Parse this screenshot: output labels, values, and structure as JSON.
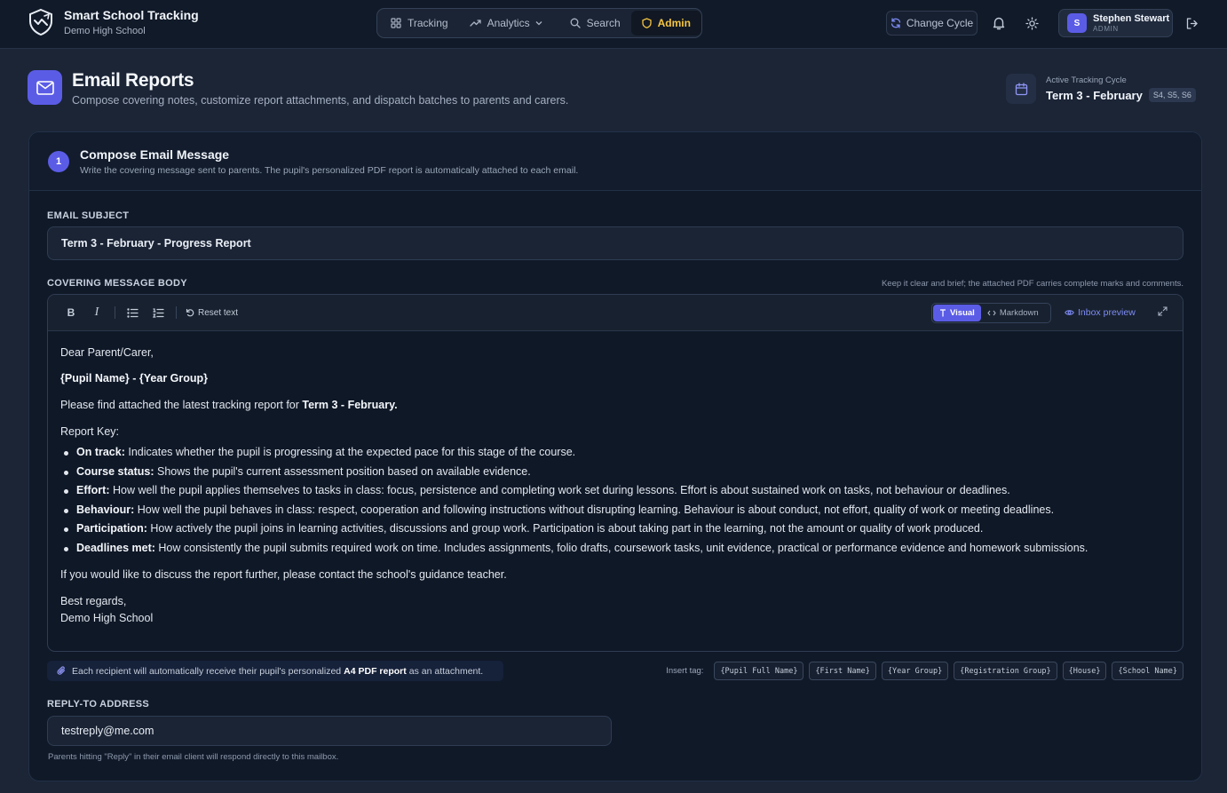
{
  "app": {
    "title": "Smart School Tracking",
    "school": "Demo High School"
  },
  "nav": {
    "items": [
      {
        "label": "Tracking",
        "icon": "grid-icon"
      },
      {
        "label": "Analytics",
        "icon": "trend-icon"
      },
      {
        "label": "Search",
        "icon": "search-icon"
      },
      {
        "label": "Admin",
        "icon": "shield-icon",
        "active": true
      }
    ]
  },
  "header_actions": {
    "change_cycle": "Change Cycle"
  },
  "user": {
    "initial": "S",
    "name": "Stephen Stewart",
    "role": "ADMIN"
  },
  "page": {
    "title": "Email Reports",
    "subtitle": "Compose covering notes, customize report attachments, and dispatch batches to parents and carers."
  },
  "cycle": {
    "label": "Active Tracking Cycle",
    "value": "Term 3 - February",
    "groups": "S4, S5, S6"
  },
  "compose": {
    "step": "1",
    "title": "Compose Email Message",
    "description": "Write the covering message sent to parents. The pupil's personalized PDF report is automatically attached to each email."
  },
  "subject": {
    "label": "EMAIL SUBJECT",
    "value": "Term 3 - February - Progress Report"
  },
  "body": {
    "label": "COVERING MESSAGE BODY",
    "hint": "Keep it clear and brief; the attached PDF carries complete marks and comments."
  },
  "toolbar": {
    "bold": "B",
    "italic": "I",
    "reset": "Reset text",
    "visual": "Visual",
    "markdown": "Markdown",
    "preview": "Inbox preview"
  },
  "message": {
    "greeting": "Dear Parent/Carer,",
    "pupil_line": "{Pupil Name} - {Year Group}",
    "intro_prefix": "Please find attached the latest tracking report for ",
    "intro_term": "Term 3 - February.",
    "key_heading": "Report Key:",
    "key_items": [
      {
        "term": "On track:",
        "text": " Indicates whether the pupil is progressing at the expected pace for this stage of the course."
      },
      {
        "term": "Course status:",
        "text": " Shows the pupil's current assessment position based on available evidence."
      },
      {
        "term": "Effort:",
        "text": " How well the pupil applies themselves to tasks in class: focus, persistence and completing work set during lessons. Effort is about sustained work on tasks, not behaviour or deadlines."
      },
      {
        "term": "Behaviour:",
        "text": " How well the pupil behaves in class: respect, cooperation and following instructions without disrupting learning. Behaviour is about conduct, not effort, quality of work or meeting deadlines."
      },
      {
        "term": "Participation:",
        "text": " How actively the pupil joins in learning activities, discussions and group work. Participation is about taking part in the learning, not the amount or quality of work produced."
      },
      {
        "term": "Deadlines met:",
        "text": " How consistently the pupil submits required work on time. Includes assignments, folio drafts, coursework tasks, unit evidence, practical or performance evidence and homework submissions."
      }
    ],
    "closing": "If you would like to discuss the report further, please contact the school's guidance teacher.",
    "sign_off": "Best regards,",
    "signature": "Demo High School"
  },
  "attachment_note": {
    "prefix": "Each recipient will automatically receive their pupil's personalized",
    "highlight": "A4 PDF report",
    "suffix": "as an attachment."
  },
  "tags": {
    "label": "Insert tag:",
    "items": [
      "{Pupil Full Name}",
      "{First Name}",
      "{Year Group}",
      "{Registration Group}",
      "{House}",
      "{School Name}"
    ]
  },
  "reply_to": {
    "label": "REPLY-TO ADDRESS",
    "value": "testreply@me.com",
    "hint": "Parents hitting \"Reply\" in their email client will respond directly to this mailbox."
  },
  "colors": {
    "accent": "#5b5ce6",
    "admin": "#f5c542",
    "link": "#7e8cf5",
    "background": "#1b2536",
    "card": "#101928"
  }
}
